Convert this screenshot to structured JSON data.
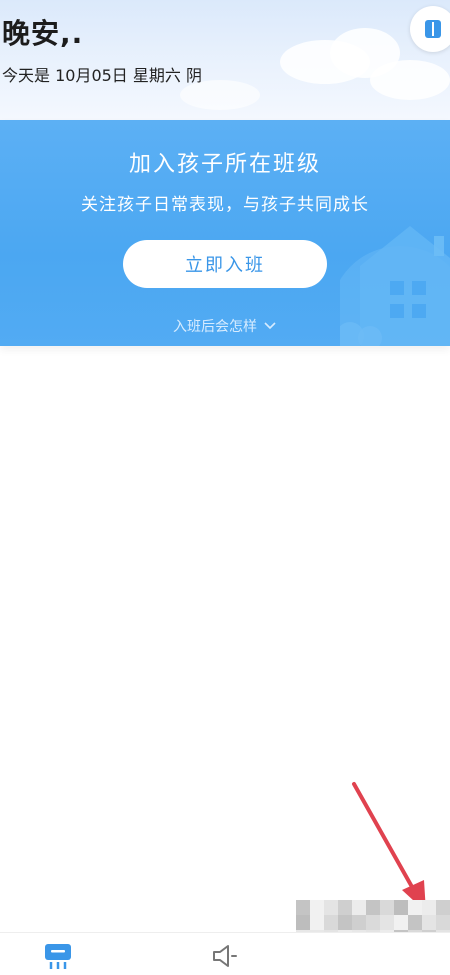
{
  "header": {
    "greeting": "晚安,.",
    "date_text": "今天是 10月05日 星期六 阴",
    "menu_icon": "panel-toggle-icon"
  },
  "join_card": {
    "title": "加入孩子所在班级",
    "subtitle": "关注孩子日常表现，与孩子共同成长",
    "button_label": "立即入班",
    "more_label": "入班后会怎样",
    "more_icon": "chevron-down-icon"
  },
  "tabbar": {
    "items": [
      {
        "icon": "home-board-icon",
        "active": true
      },
      {
        "icon": "speaker-icon",
        "active": false
      }
    ]
  },
  "colors": {
    "accent": "#3a96e8",
    "card_blue": "#4ba7f2",
    "annotation_red": "#e0424f"
  }
}
